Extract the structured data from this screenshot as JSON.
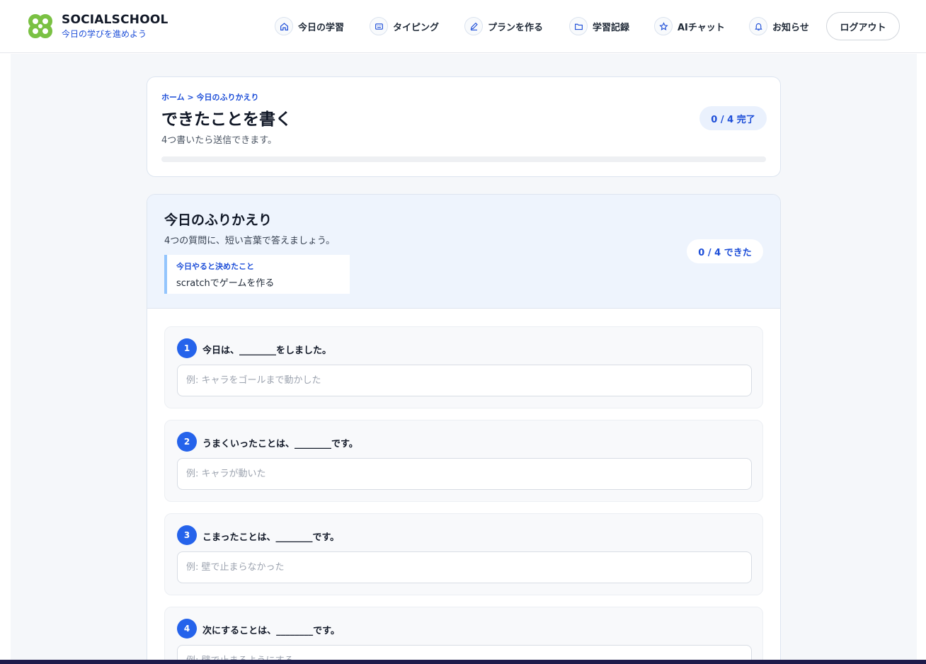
{
  "brand": {
    "name": "SOCIALSCHOOL",
    "tagline": "今日の学びを進めよう"
  },
  "nav": [
    {
      "label": "今日の学習",
      "icon": "home-icon"
    },
    {
      "label": "タイピング",
      "icon": "keyboard-icon"
    },
    {
      "label": "プランを作る",
      "icon": "pencil-icon"
    },
    {
      "label": "学習記録",
      "icon": "folder-icon"
    },
    {
      "label": "AIチャット",
      "icon": "star-icon"
    },
    {
      "label": "お知らせ",
      "icon": "bell-icon"
    }
  ],
  "logout_label": "ログアウト",
  "header_card": {
    "breadcrumb": "ホーム > 今日のふりかえり",
    "title": "できたことを書く",
    "subtitle": "4つ書いたら送信できます。",
    "done_badge": "0 / 4 完了",
    "progress": 0
  },
  "reflection": {
    "title": "今日のふりかえり",
    "subtitle": "4つの質問に、短い言葉で答えましょう。",
    "plan_label": "今日やると決めたこと",
    "plan_value": "scratchでゲームを作る",
    "count_badge": "0 / 4 できた",
    "questions": [
      {
        "num": "1",
        "text": "今日は、________をしました。",
        "placeholder": "例: キャラをゴールまで動かした",
        "value": ""
      },
      {
        "num": "2",
        "text": "うまくいったことは、________です。",
        "placeholder": "例: キャラが動いた",
        "value": ""
      },
      {
        "num": "3",
        "text": "こまったことは、________です。",
        "placeholder": "例: 壁で止まらなかった",
        "value": ""
      },
      {
        "num": "4",
        "text": "次にすることは、________です。",
        "placeholder": "例: 壁で止まるようにする",
        "value": ""
      }
    ]
  },
  "colors": {
    "accent": "#2563eb",
    "brand_green": "#7ac143",
    "link": "#1d4ed8"
  }
}
